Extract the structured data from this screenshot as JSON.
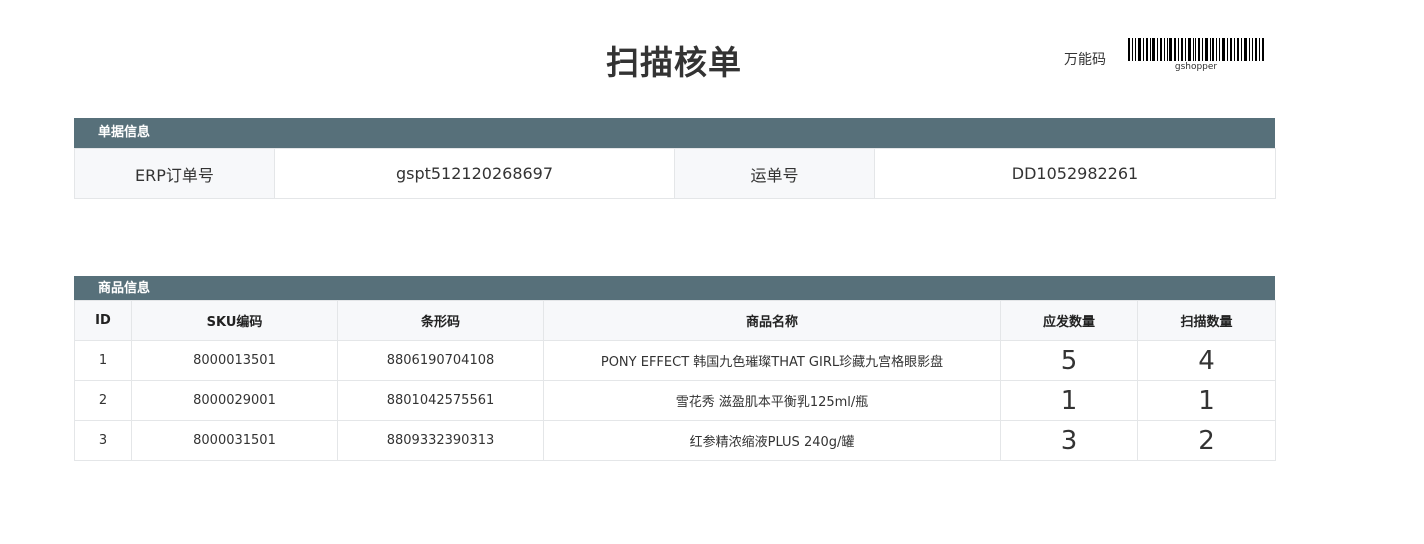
{
  "header": {
    "title": "扫描核单",
    "universal_code_label": "万能码",
    "barcode_text": "gshopper"
  },
  "doc_info": {
    "section_title": "单据信息",
    "erp_label": "ERP订单号",
    "erp_value": "gspt512120268697",
    "waybill_label": "运单号",
    "waybill_value": "DD1052982261"
  },
  "goods_info": {
    "section_title": "商品信息",
    "columns": [
      "ID",
      "SKU编码",
      "条形码",
      "商品名称",
      "应发数量",
      "扫描数量"
    ],
    "rows": [
      {
        "id": "1",
        "sku": "8000013501",
        "barcode": "8806190704108",
        "name": "PONY EFFECT 韩国九色璀璨THAT GIRL珍藏九宫格眼影盘",
        "expected": "5",
        "scanned": "4"
      },
      {
        "id": "2",
        "sku": "8000029001",
        "barcode": "8801042575561",
        "name": "雪花秀 滋盈肌本平衡乳125ml/瓶",
        "expected": "1",
        "scanned": "1"
      },
      {
        "id": "3",
        "sku": "8000031501",
        "barcode": "8809332390313",
        "name": "红参精浓缩液PLUS 240g/罐",
        "expected": "3",
        "scanned": "2"
      }
    ]
  }
}
